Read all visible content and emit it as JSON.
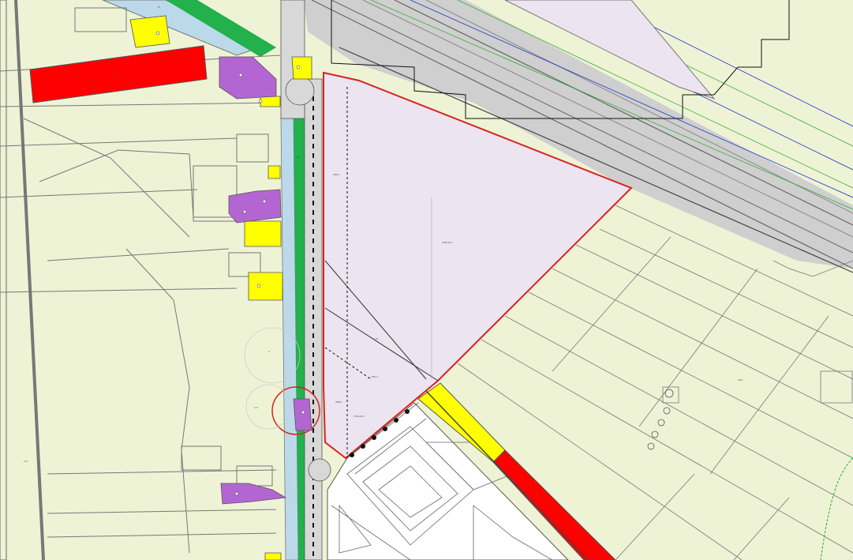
{
  "map": {
    "colors": {
      "agricultural": "#eef3d6",
      "plan_area": "#ece4f0",
      "plan_boundary": "#d9231f",
      "water": "#bcd9ea",
      "greenery": "#22b14c",
      "commercial": "#ff0000",
      "residential_yellow": "#ffff00",
      "community_purple": "#b366d1",
      "railway": "#d2d2d2",
      "built_up": "#ffffff",
      "parcel_line": "#777777",
      "wire_blue": "#2233cc",
      "wire_green": "#22aa22"
    },
    "labels": {
      "main_area": "GTB-AO1",
      "area_a": "WN-R",
      "area_b": "L-P1",
      "area_c": "LMS-S",
      "area_d": "WN-R",
      "area_e": "GTB-AO3",
      "area_f": "A-P",
      "field_west": "A",
      "field_east": "AGR",
      "field_south": "A-P",
      "canal": "W",
      "red_north": "B-H",
      "green_strip": "GR"
    }
  }
}
